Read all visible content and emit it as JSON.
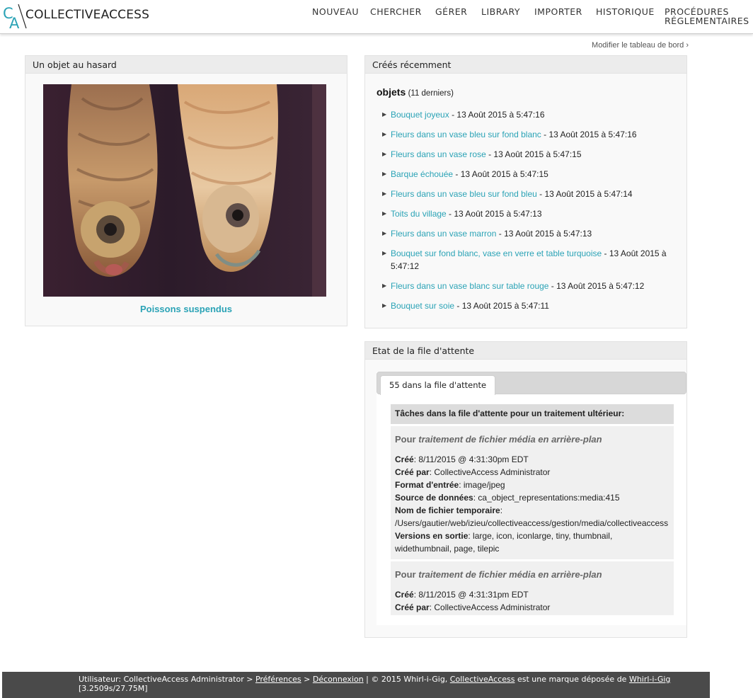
{
  "header": {
    "logo_text": "COLLECTIVEACCESS",
    "nav": [
      {
        "label": "NOUVEAU"
      },
      {
        "label": "CHERCHER"
      },
      {
        "label": "GÉRER"
      },
      {
        "label": "LIBRARY"
      },
      {
        "label": "IMPORTER"
      },
      {
        "label": "HISTORIQUE"
      },
      {
        "label": "PROCÉDURES",
        "label2": "RÉGLEMENTAIRES"
      }
    ]
  },
  "dashboard_link": "Modifier le tableau de bord ›",
  "random_object": {
    "heading": "Un objet au hasard",
    "title": "Poissons suspendus"
  },
  "recent": {
    "heading": "Créés récemment",
    "type_label": "objets",
    "count_label": "(11 derniers)",
    "items": [
      {
        "name": "Bouquet joyeux",
        "date": " - 13 Août 2015 à 5:47:16"
      },
      {
        "name": "Fleurs dans un vase bleu sur fond blanc",
        "date": " - 13 Août 2015 à 5:47:16"
      },
      {
        "name": "Fleurs dans un vase rose",
        "date": " - 13 Août 2015 à 5:47:15"
      },
      {
        "name": "Barque échouée",
        "date": " - 13 Août 2015 à 5:47:15"
      },
      {
        "name": "Fleurs dans un vase bleu sur fond bleu",
        "date": " - 13 Août 2015 à 5:47:14"
      },
      {
        "name": "Toits du village",
        "date": " - 13 Août 2015 à 5:47:13"
      },
      {
        "name": "Fleurs dans un vase marron",
        "date": " - 13 Août 2015 à 5:47:13"
      },
      {
        "name": "Bouquet sur fond blanc, vase en verre et table turquoise",
        "date": " - 13 Août 2015 à 5:47:12"
      },
      {
        "name": "Fleurs dans un vase blanc sur table rouge",
        "date": " - 13 Août 2015 à 5:47:12"
      },
      {
        "name": "Bouquet sur soie",
        "date": " - 13 Août 2015 à 5:47:11"
      }
    ]
  },
  "queue": {
    "heading": "Etat de la file d'attente",
    "tab_label": "55 dans la file d'attente",
    "list_title": "Tâches dans la file d'attente pour un traitement ultérieur:",
    "items": [
      {
        "head_prefix": "Pour ",
        "head_task": "traitement de fichier média en arrière-plan",
        "created_label": "Créé",
        "created": ": 8/11/2015 @ 4:31:30pm EDT",
        "by_label": "Créé par",
        "by": ": CollectiveAccess Administrator",
        "format_label": "Format d'entrée",
        "format": ": image/jpeg",
        "source_label": "Source de données",
        "source": ": ca_object_representations:media:415",
        "tmp_label": "Nom de fichier temporaire",
        "tmp": ":",
        "tmp_path": "/Users/gautier/web/izieu/collectiveaccess/gestion/media/collectiveaccess",
        "versions_label": "Versions en sortie",
        "versions": ": large, icon, iconlarge, tiny, thumbnail, widethumbnail, page, tilepic"
      },
      {
        "head_prefix": "Pour ",
        "head_task": "traitement de fichier média en arrière-plan",
        "created_label": "Créé",
        "created": ": 8/11/2015 @ 4:31:31pm EDT",
        "by_label": "Créé par",
        "by": ": CollectiveAccess Administrator"
      }
    ]
  },
  "footer": {
    "user_prefix": "Utilisateur: CollectiveAccess Administrator > ",
    "prefs": "Préférences",
    "sep1": " > ",
    "logout": "Déconnexion",
    "sep2": "  |  © 2015 Whirl-i-Gig, ",
    "ca": "CollectiveAccess",
    "trademark": " est une marque déposée de ",
    "wig": "Whirl-i-Gig",
    "stats": "[3.2509s/27.75M]"
  },
  "colors": {
    "accent": "#2ba3b6",
    "footer_bg": "#4a4a4a",
    "panel_bg": "#f9f9f9"
  }
}
